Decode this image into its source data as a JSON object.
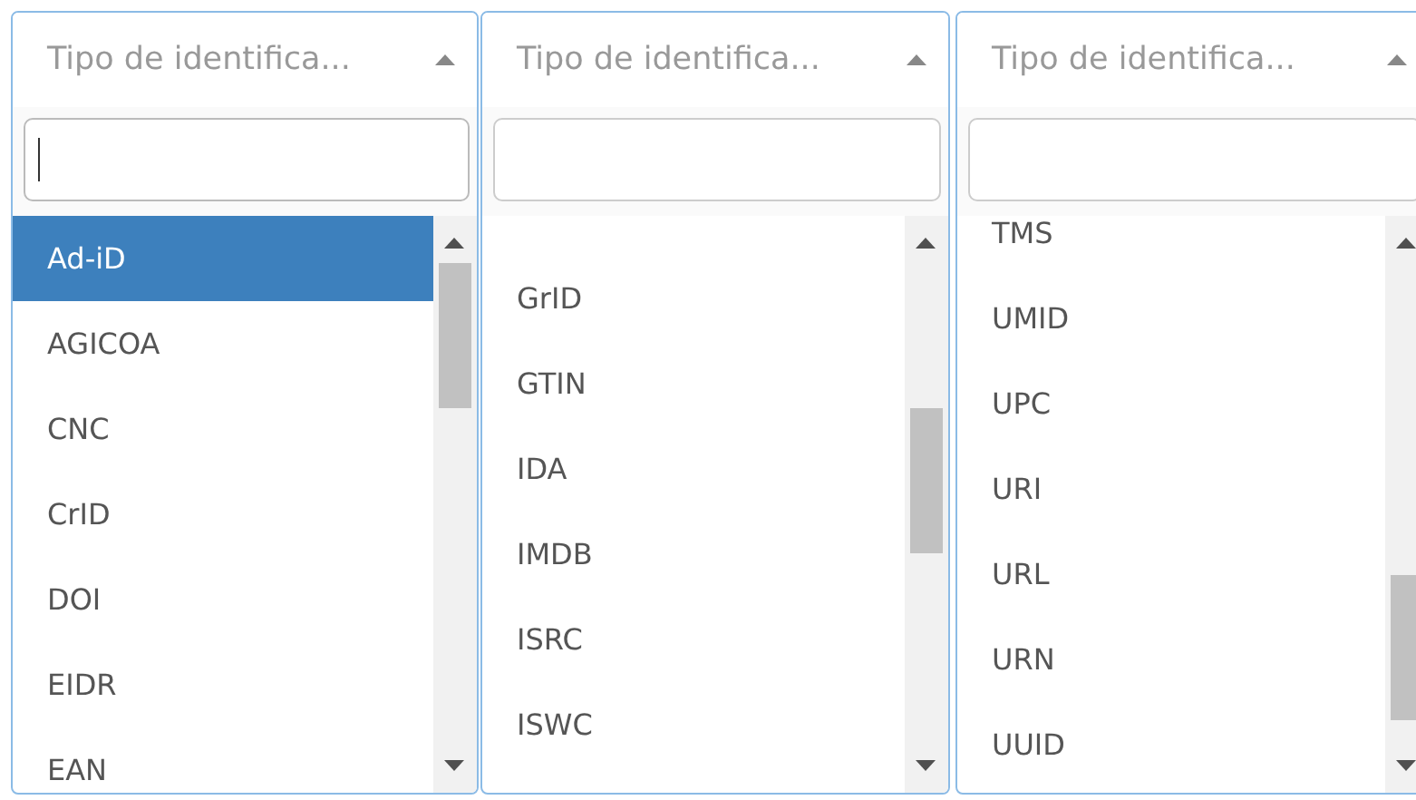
{
  "dropdowns": [
    {
      "placeholder": "Tipo de identifica...",
      "expanded": true,
      "search": {
        "focused": true
      },
      "options": [
        {
          "label": "Ad-iD",
          "selected": true
        },
        {
          "label": "AGICOA",
          "selected": false
        },
        {
          "label": "CNC",
          "selected": false
        },
        {
          "label": "CrID",
          "selected": false
        },
        {
          "label": "DOI",
          "selected": false
        },
        {
          "label": "EIDR",
          "selected": false
        },
        {
          "label": "EAN",
          "selected": false
        }
      ]
    },
    {
      "placeholder": "Tipo de identifica...",
      "expanded": true,
      "search": {
        "focused": false
      },
      "options": [
        {
          "label": "GrID",
          "selected": false
        },
        {
          "label": "GTIN",
          "selected": false
        },
        {
          "label": "IDA",
          "selected": false
        },
        {
          "label": "IMDB",
          "selected": false
        },
        {
          "label": "ISRC",
          "selected": false
        },
        {
          "label": "ISWC",
          "selected": false
        }
      ]
    },
    {
      "placeholder": "Tipo de identifica...",
      "expanded": true,
      "search": {
        "focused": false
      },
      "options": [
        {
          "label": "TMS",
          "selected": false
        },
        {
          "label": "UMID",
          "selected": false
        },
        {
          "label": "UPC",
          "selected": false
        },
        {
          "label": "URI",
          "selected": false
        },
        {
          "label": "URL",
          "selected": false
        },
        {
          "label": "URN",
          "selected": false
        },
        {
          "label": "UUID",
          "selected": false
        }
      ]
    }
  ]
}
